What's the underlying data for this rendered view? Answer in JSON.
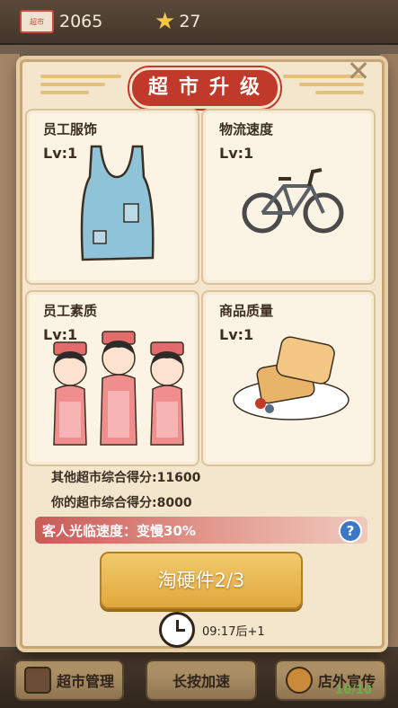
{
  "hud": {
    "tickets": "2065",
    "stars": "27",
    "ticket_label": "超市"
  },
  "dialog": {
    "title": "超市升级",
    "close": "✕",
    "cards": [
      {
        "name": "员工服饰",
        "level": "Lv:1",
        "icon": "tank-top-icon"
      },
      {
        "name": "物流速度",
        "level": "Lv:1",
        "icon": "bicycle-icon"
      },
      {
        "name": "员工素质",
        "level": "Lv:1",
        "icon": "staff-icon"
      },
      {
        "name": "商品质量",
        "level": "Lv:1",
        "icon": "bread-icon"
      }
    ],
    "other_score": "其他超市综合得分:11600",
    "your_score": "你的超市综合得分:8000",
    "debuff": "客人光临速度：变慢30%",
    "help": "?",
    "action_button": "淘硬件2/3",
    "timer": "09:17后+1"
  },
  "bottom": {
    "manage": "超市管理",
    "speed": "长按加速",
    "promo": "店外宣传",
    "promo_count": "10/10"
  },
  "colors": {
    "title_red": "#c0392b",
    "button_gold": "#e0a83d",
    "help_blue": "#3b78c8"
  }
}
